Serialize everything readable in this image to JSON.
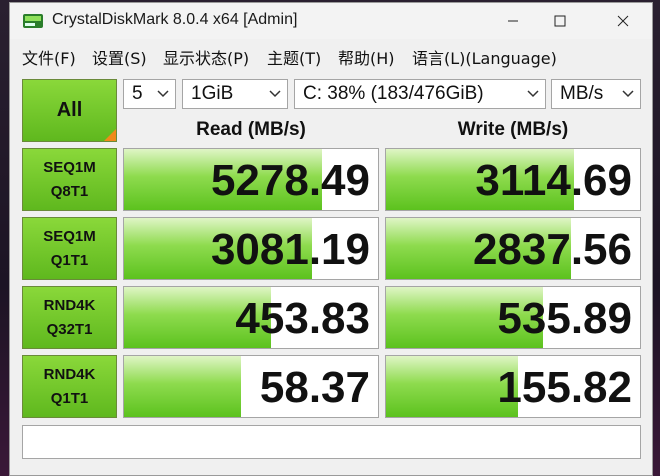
{
  "window": {
    "title": "CrystalDiskMark 8.0.4 x64 [Admin]"
  },
  "menu": {
    "file": "文件(F)",
    "settings": "设置(S)",
    "display": "显示状态(P)",
    "theme": "主题(T)",
    "help": "帮助(H)",
    "language": "语言(L)(Language)"
  },
  "controls": {
    "all_label": "All",
    "count": "5",
    "size": "1GiB",
    "drive": "C: 38% (183/476GiB)",
    "unit": "MB/s"
  },
  "headers": {
    "read": "Read (MB/s)",
    "write": "Write (MB/s)"
  },
  "rows": [
    {
      "line1": "SEQ1M",
      "line2": "Q8T1",
      "read": "5278.49",
      "write": "3114.69",
      "read_fill": 0.78,
      "write_fill": 0.74
    },
    {
      "line1": "SEQ1M",
      "line2": "Q1T1",
      "read": "3081.19",
      "write": "2837.56",
      "read_fill": 0.74,
      "write_fill": 0.73
    },
    {
      "line1": "RND4K",
      "line2": "Q32T1",
      "read": "453.83",
      "write": "535.89",
      "read_fill": 0.58,
      "write_fill": 0.62
    },
    {
      "line1": "RND4K",
      "line2": "Q1T1",
      "read": "58.37",
      "write": "155.82",
      "read_fill": 0.46,
      "write_fill": 0.52
    }
  ],
  "comment": "",
  "colors": {
    "accent_green": "#5fb81e",
    "corner_orange": "#f08a1a"
  }
}
